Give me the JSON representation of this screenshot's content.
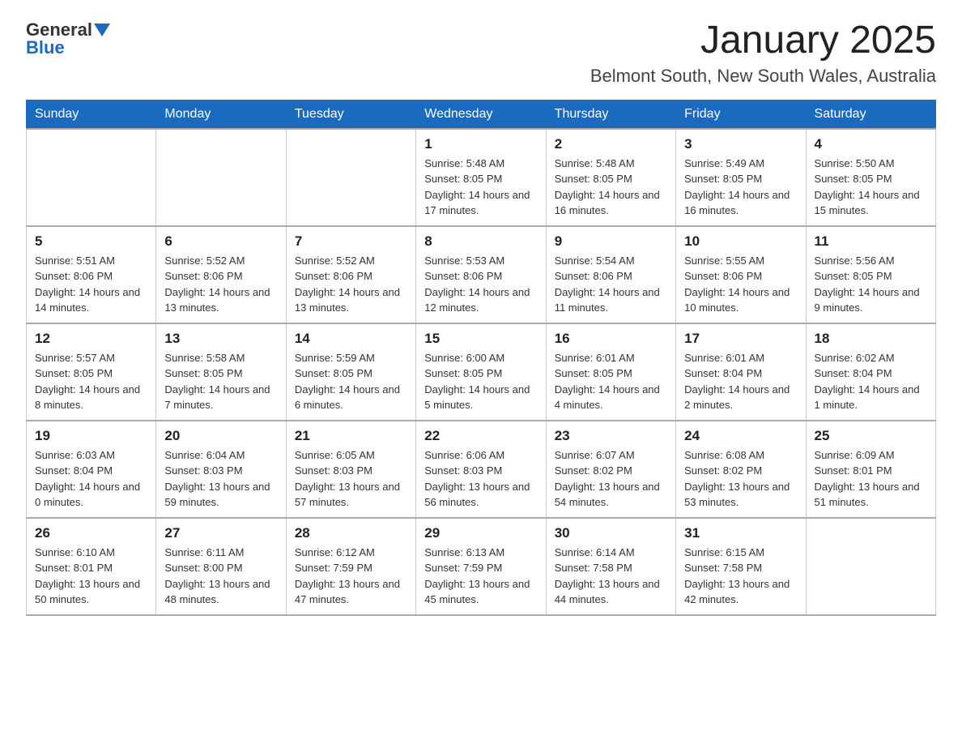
{
  "header": {
    "title": "January 2025",
    "location": "Belmont South, New South Wales, Australia",
    "logo_general": "General",
    "logo_blue": "Blue"
  },
  "days_of_week": [
    "Sunday",
    "Monday",
    "Tuesday",
    "Wednesday",
    "Thursday",
    "Friday",
    "Saturday"
  ],
  "weeks": [
    [
      {
        "day": "",
        "info": ""
      },
      {
        "day": "",
        "info": ""
      },
      {
        "day": "",
        "info": ""
      },
      {
        "day": "1",
        "info": "Sunrise: 5:48 AM\nSunset: 8:05 PM\nDaylight: 14 hours\nand 17 minutes."
      },
      {
        "day": "2",
        "info": "Sunrise: 5:48 AM\nSunset: 8:05 PM\nDaylight: 14 hours\nand 16 minutes."
      },
      {
        "day": "3",
        "info": "Sunrise: 5:49 AM\nSunset: 8:05 PM\nDaylight: 14 hours\nand 16 minutes."
      },
      {
        "day": "4",
        "info": "Sunrise: 5:50 AM\nSunset: 8:05 PM\nDaylight: 14 hours\nand 15 minutes."
      }
    ],
    [
      {
        "day": "5",
        "info": "Sunrise: 5:51 AM\nSunset: 8:06 PM\nDaylight: 14 hours\nand 14 minutes."
      },
      {
        "day": "6",
        "info": "Sunrise: 5:52 AM\nSunset: 8:06 PM\nDaylight: 14 hours\nand 13 minutes."
      },
      {
        "day": "7",
        "info": "Sunrise: 5:52 AM\nSunset: 8:06 PM\nDaylight: 14 hours\nand 13 minutes."
      },
      {
        "day": "8",
        "info": "Sunrise: 5:53 AM\nSunset: 8:06 PM\nDaylight: 14 hours\nand 12 minutes."
      },
      {
        "day": "9",
        "info": "Sunrise: 5:54 AM\nSunset: 8:06 PM\nDaylight: 14 hours\nand 11 minutes."
      },
      {
        "day": "10",
        "info": "Sunrise: 5:55 AM\nSunset: 8:06 PM\nDaylight: 14 hours\nand 10 minutes."
      },
      {
        "day": "11",
        "info": "Sunrise: 5:56 AM\nSunset: 8:05 PM\nDaylight: 14 hours\nand 9 minutes."
      }
    ],
    [
      {
        "day": "12",
        "info": "Sunrise: 5:57 AM\nSunset: 8:05 PM\nDaylight: 14 hours\nand 8 minutes."
      },
      {
        "day": "13",
        "info": "Sunrise: 5:58 AM\nSunset: 8:05 PM\nDaylight: 14 hours\nand 7 minutes."
      },
      {
        "day": "14",
        "info": "Sunrise: 5:59 AM\nSunset: 8:05 PM\nDaylight: 14 hours\nand 6 minutes."
      },
      {
        "day": "15",
        "info": "Sunrise: 6:00 AM\nSunset: 8:05 PM\nDaylight: 14 hours\nand 5 minutes."
      },
      {
        "day": "16",
        "info": "Sunrise: 6:01 AM\nSunset: 8:05 PM\nDaylight: 14 hours\nand 4 minutes."
      },
      {
        "day": "17",
        "info": "Sunrise: 6:01 AM\nSunset: 8:04 PM\nDaylight: 14 hours\nand 2 minutes."
      },
      {
        "day": "18",
        "info": "Sunrise: 6:02 AM\nSunset: 8:04 PM\nDaylight: 14 hours\nand 1 minute."
      }
    ],
    [
      {
        "day": "19",
        "info": "Sunrise: 6:03 AM\nSunset: 8:04 PM\nDaylight: 14 hours\nand 0 minutes."
      },
      {
        "day": "20",
        "info": "Sunrise: 6:04 AM\nSunset: 8:03 PM\nDaylight: 13 hours\nand 59 minutes."
      },
      {
        "day": "21",
        "info": "Sunrise: 6:05 AM\nSunset: 8:03 PM\nDaylight: 13 hours\nand 57 minutes."
      },
      {
        "day": "22",
        "info": "Sunrise: 6:06 AM\nSunset: 8:03 PM\nDaylight: 13 hours\nand 56 minutes."
      },
      {
        "day": "23",
        "info": "Sunrise: 6:07 AM\nSunset: 8:02 PM\nDaylight: 13 hours\nand 54 minutes."
      },
      {
        "day": "24",
        "info": "Sunrise: 6:08 AM\nSunset: 8:02 PM\nDaylight: 13 hours\nand 53 minutes."
      },
      {
        "day": "25",
        "info": "Sunrise: 6:09 AM\nSunset: 8:01 PM\nDaylight: 13 hours\nand 51 minutes."
      }
    ],
    [
      {
        "day": "26",
        "info": "Sunrise: 6:10 AM\nSunset: 8:01 PM\nDaylight: 13 hours\nand 50 minutes."
      },
      {
        "day": "27",
        "info": "Sunrise: 6:11 AM\nSunset: 8:00 PM\nDaylight: 13 hours\nand 48 minutes."
      },
      {
        "day": "28",
        "info": "Sunrise: 6:12 AM\nSunset: 7:59 PM\nDaylight: 13 hours\nand 47 minutes."
      },
      {
        "day": "29",
        "info": "Sunrise: 6:13 AM\nSunset: 7:59 PM\nDaylight: 13 hours\nand 45 minutes."
      },
      {
        "day": "30",
        "info": "Sunrise: 6:14 AM\nSunset: 7:58 PM\nDaylight: 13 hours\nand 44 minutes."
      },
      {
        "day": "31",
        "info": "Sunrise: 6:15 AM\nSunset: 7:58 PM\nDaylight: 13 hours\nand 42 minutes."
      },
      {
        "day": "",
        "info": ""
      }
    ]
  ]
}
